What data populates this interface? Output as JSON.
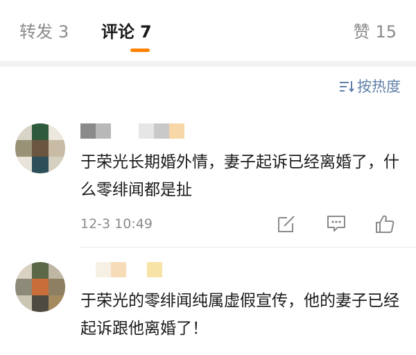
{
  "tabs": {
    "repost": {
      "label": "转发",
      "count": "3"
    },
    "comment": {
      "label": "评论",
      "count": "7"
    },
    "like": {
      "label": "赞",
      "count": "15"
    }
  },
  "sort": {
    "icon": "sort-lines-icon",
    "label": "按热度"
  },
  "colors": {
    "accent": "#ff8200",
    "link": "#5f7fa8",
    "muted": "#8a8a8a"
  },
  "comments": [
    {
      "text": "于荣光长期婚外情，妻子起诉已经离婚了，什么零绯闻都是扯",
      "time": "12-3 10:49",
      "actions": [
        "share-edit-icon",
        "comment-bubble-icon",
        "thumbs-up-icon"
      ]
    },
    {
      "text": "于荣光的零绯闻纯属虚假宣传，他的妻子已经起诉跟他离婚了！"
    }
  ]
}
